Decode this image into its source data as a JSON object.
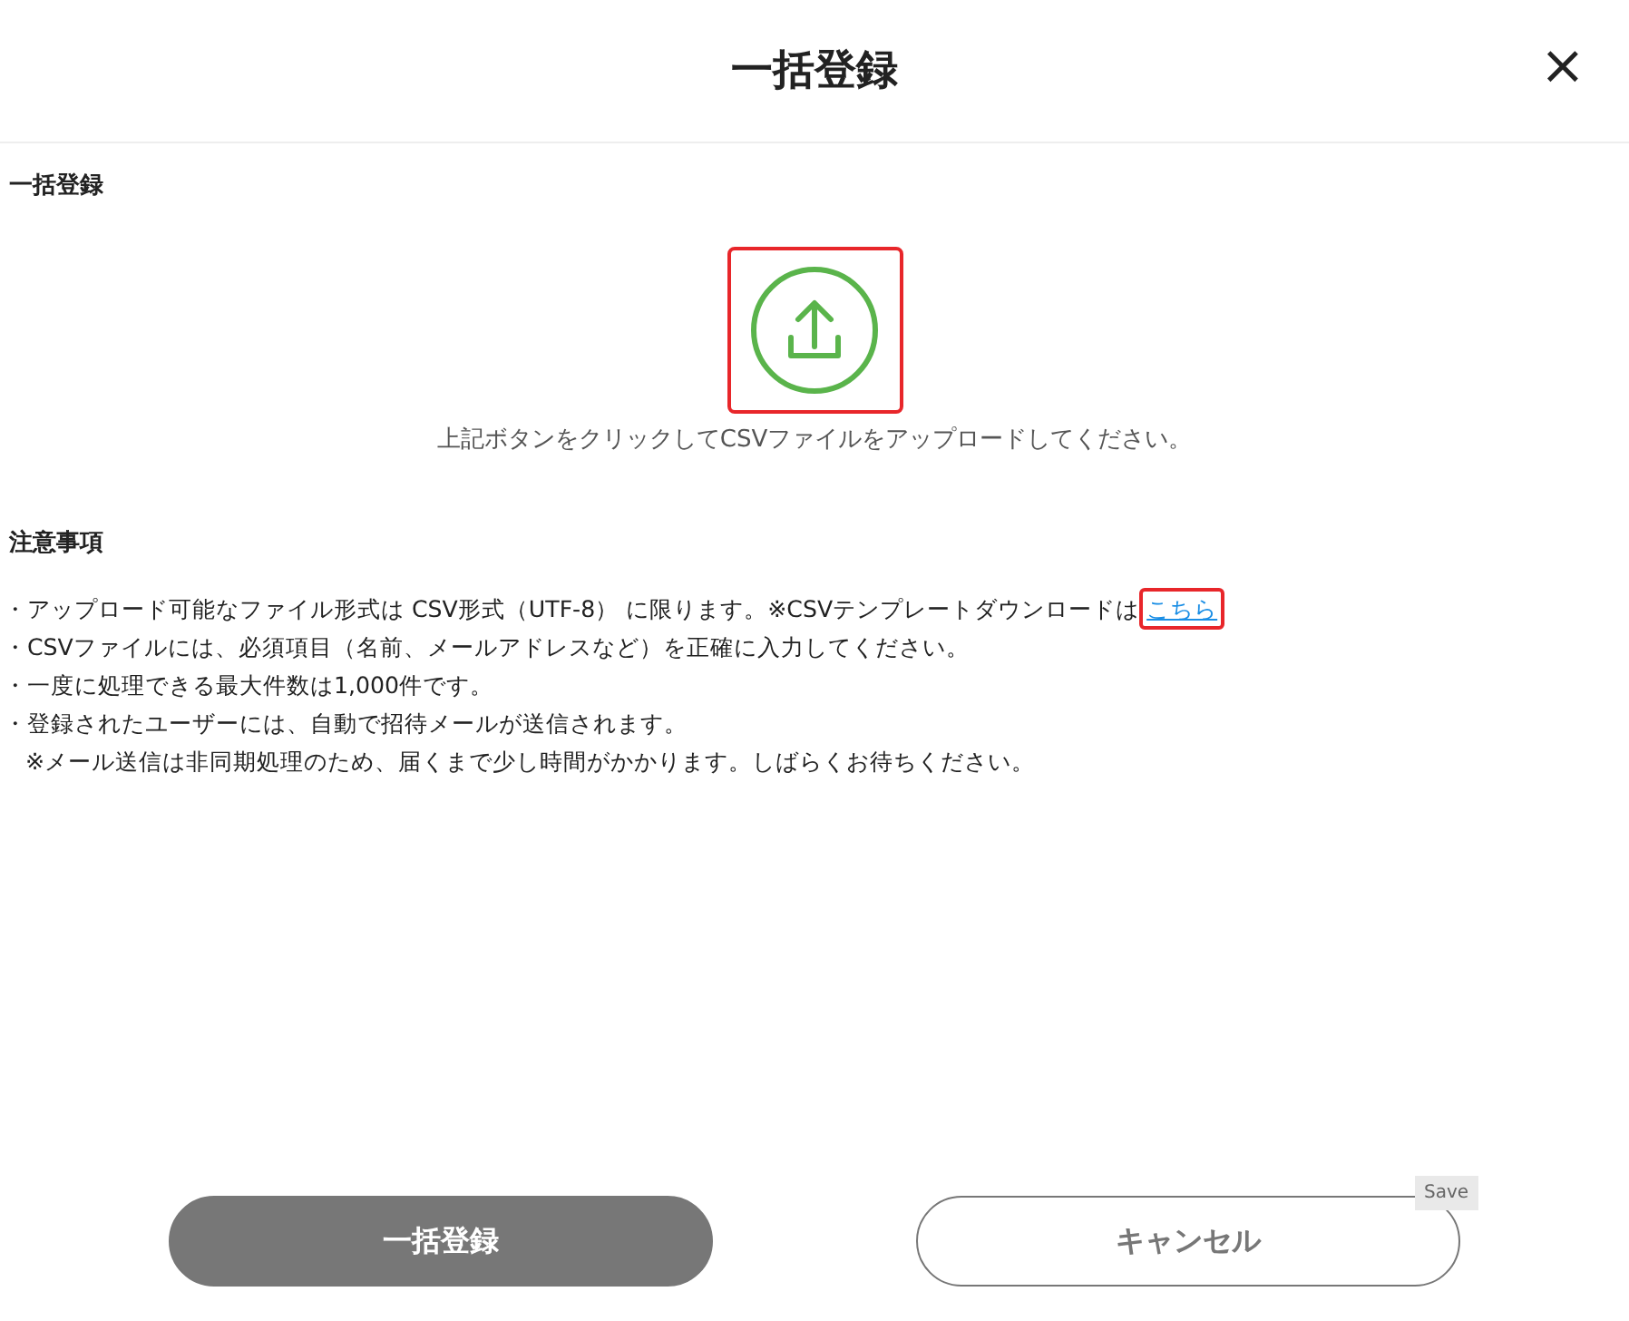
{
  "dialog": {
    "title": "一括登録",
    "close": "×"
  },
  "section_label": "一括登録",
  "upload": {
    "highlighted": true,
    "caption": "上記ボタンをクリックしてCSVファイルをアップロードしてください。"
  },
  "notes": {
    "heading": "注意事項",
    "items": [
      {
        "kind": "bullet",
        "text": "・アップロード可能なファイル形式は CSV形式（UTF-8） に限ります。※CSVテンプレートダウンロードは",
        "link": {
          "text": "こちら",
          "highlighted": true
        }
      },
      {
        "kind": "bullet",
        "text": "・CSVファイルには、必須項目（名前、メールアドレスなど）を正確に入力してください。"
      },
      {
        "kind": "bullet",
        "text": "・一度に処理できる最大件数は1,000件です。"
      },
      {
        "kind": "bullet",
        "text": "・登録されたユーザーには、自動で招待メールが送信されます。"
      },
      {
        "kind": "continuation",
        "text": "※メール送信は非同期処理のため、届くまで少し時間がかかります。しばらくお待ちください。"
      }
    ]
  },
  "buttons": [
    {
      "kind": "primary",
      "label": "一括登録"
    },
    {
      "kind": "secondary",
      "label": "キャンセル"
    }
  ],
  "save_tag": "Save"
}
